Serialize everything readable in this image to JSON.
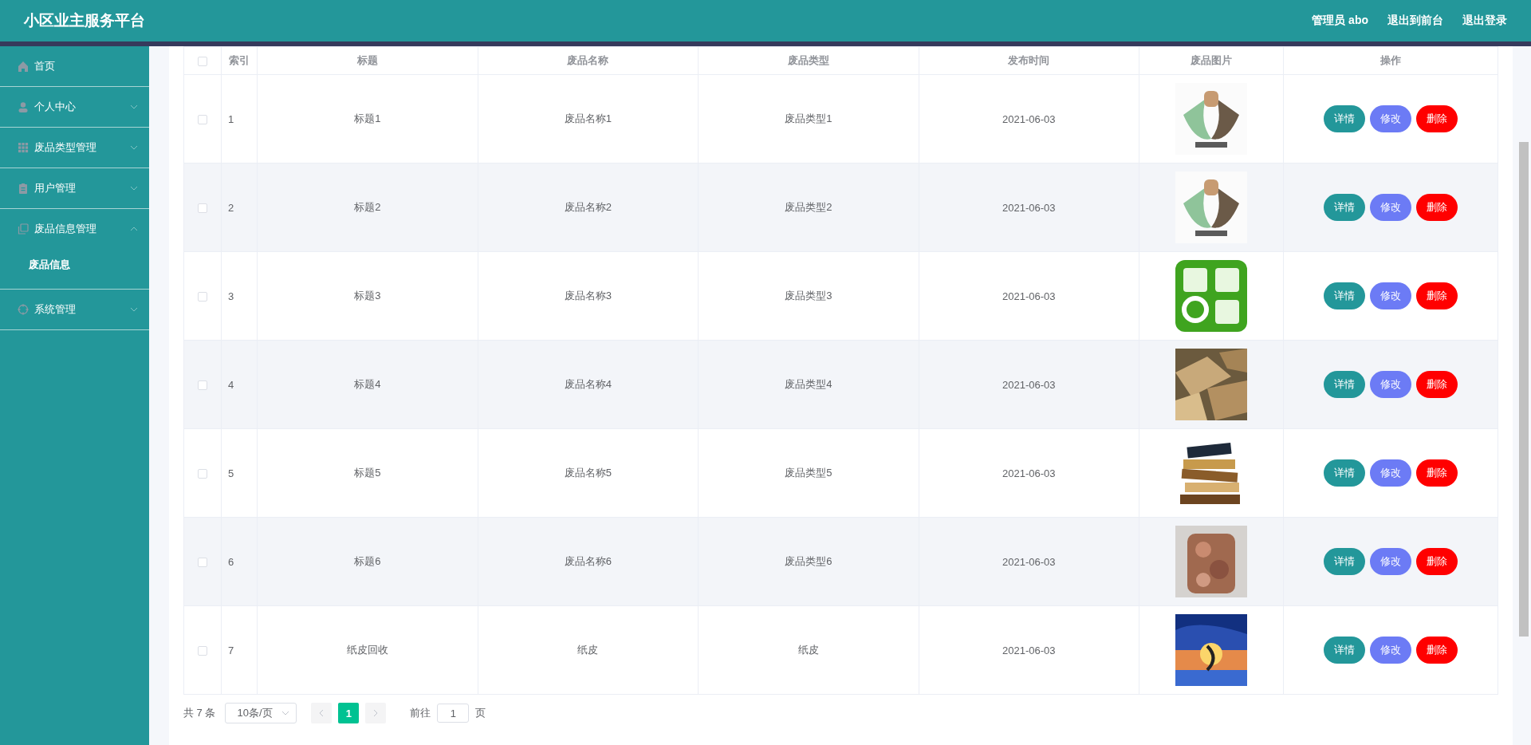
{
  "header": {
    "title": "小区业主服务平台",
    "user": "管理员 abo",
    "links": [
      "退出到前台",
      "退出登录"
    ]
  },
  "sidebar": {
    "items": [
      {
        "label": "首页"
      },
      {
        "label": "个人中心",
        "expanded": false
      },
      {
        "label": "废品类型管理",
        "expanded": false
      },
      {
        "label": "用户管理",
        "expanded": false
      },
      {
        "label": "废品信息管理",
        "expanded": true,
        "children": [
          {
            "label": "废品信息"
          }
        ]
      },
      {
        "label": "系统管理",
        "expanded": false
      }
    ]
  },
  "table": {
    "all_checked": false,
    "columns": [
      "索引",
      "标题",
      "废品名称",
      "废品类型",
      "发布时间",
      "废品图片",
      "操作"
    ],
    "rows": [
      {
        "checked": false,
        "index": "1",
        "title": "标题1",
        "name": "废品名称1",
        "type": "废品类型1",
        "time": "2021-06-03",
        "actions": [
          "详情",
          "修改",
          "删除"
        ]
      },
      {
        "checked": false,
        "index": "2",
        "title": "标题2",
        "name": "废品名称2",
        "type": "废品类型2",
        "time": "2021-06-03",
        "actions": [
          "详情",
          "修改",
          "删除"
        ]
      },
      {
        "checked": false,
        "index": "3",
        "title": "标题3",
        "name": "废品名称3",
        "type": "废品类型3",
        "time": "2021-06-03",
        "actions": [
          "详情",
          "修改",
          "删除"
        ]
      },
      {
        "checked": false,
        "index": "4",
        "title": "标题4",
        "name": "废品名称4",
        "type": "废品类型4",
        "time": "2021-06-03",
        "actions": [
          "详情",
          "修改",
          "删除"
        ]
      },
      {
        "checked": false,
        "index": "5",
        "title": "标题5",
        "name": "废品名称5",
        "type": "废品类型5",
        "time": "2021-06-03",
        "actions": [
          "详情",
          "修改",
          "删除"
        ]
      },
      {
        "checked": false,
        "index": "6",
        "title": "标题6",
        "name": "废品名称6",
        "type": "废品类型6",
        "time": "2021-06-03",
        "actions": [
          "详情",
          "修改",
          "删除"
        ]
      },
      {
        "checked": false,
        "index": "7",
        "title": "纸皮回收",
        "name": "纸皮",
        "type": "纸皮",
        "time": "2021-06-03",
        "actions": [
          "详情",
          "修改",
          "删除"
        ]
      }
    ]
  },
  "pagination": {
    "total": "共 7 条",
    "page_size": "10条/页",
    "pages": [
      {
        "label": "1",
        "selected": true
      }
    ],
    "goto_label": "前往",
    "goto_value": "1",
    "goto_suffix": "页"
  }
}
